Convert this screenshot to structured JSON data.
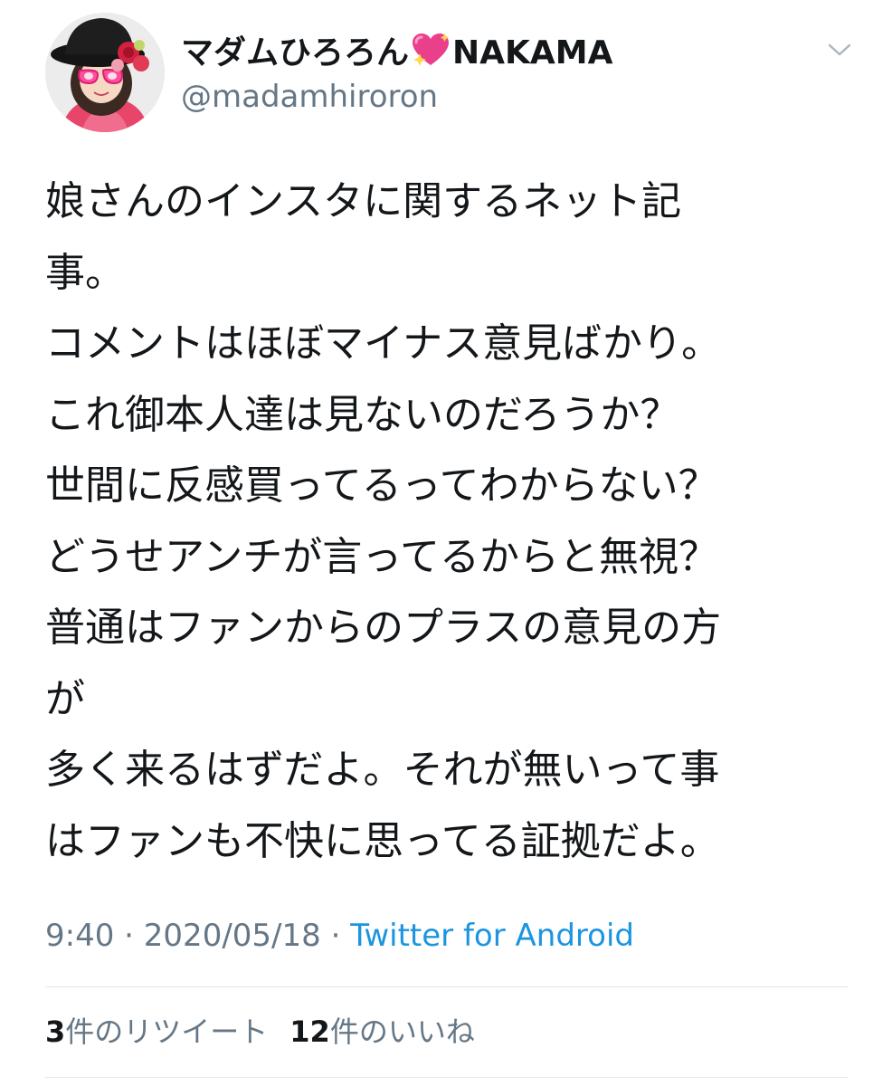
{
  "user": {
    "display_name_before": "マダムひろろん",
    "display_name_emoji": "sparkling-heart-icon",
    "display_name_after": "NAKAMA",
    "handle": "@madamhiroron"
  },
  "tweet": {
    "lines": [
      "娘さんのインスタに関するネット記",
      "事。",
      "コメントはほぼマイナス意見ばかり。",
      "これ御本人達は見ないのだろうか？",
      "世間に反感買ってるってわからない？",
      "どうせアンチが言ってるからと無視？",
      "普通はファンからのプラスの意見の方",
      "が",
      "多く来るはずだよ。それが無いって事",
      "はファンも不快に思ってる証拠だよ。"
    ]
  },
  "meta": {
    "time": "9:40",
    "separator": "·",
    "date": "2020/05/18",
    "source": "Twitter for Android"
  },
  "stats": {
    "retweet_count": "3",
    "retweet_label": "件のリツイート",
    "like_count": "12",
    "like_label": "件のいいね"
  },
  "colors": {
    "text": "#14171a",
    "muted": "#657786",
    "link": "#1b95e0",
    "divider": "#e1e8ed",
    "heart": "#e0245e"
  }
}
